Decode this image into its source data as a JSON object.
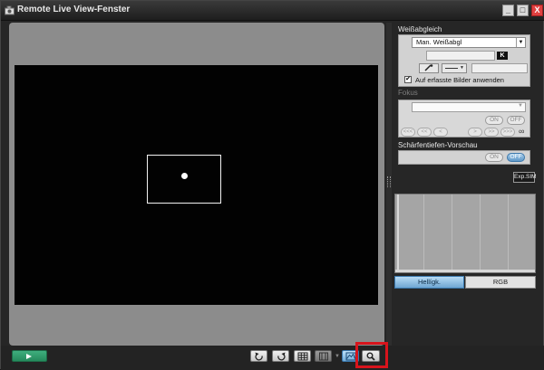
{
  "window": {
    "title": "Remote Live View-Fenster",
    "controls": [
      "_",
      "□",
      "X"
    ]
  },
  "preview": {
    "focus_frame": true,
    "background_color": "#020202"
  },
  "white_balance": {
    "header": "Weißabgleich",
    "mode": "Man. Weißabgl",
    "kelvin_badge": "K",
    "apply_checked": true,
    "apply_label": "Auf erfasste Bilder anwenden"
  },
  "focus": {
    "header": "Fokus",
    "on_label": "ON",
    "off_label": "OFF",
    "nav": [
      "<<<",
      "<<",
      "<",
      ">",
      ">>",
      ">>>"
    ],
    "infinity": "∞"
  },
  "depth_of_field": {
    "header": "Schärfentiefen-Vorschau",
    "on_label": "ON",
    "off_label": "OFF",
    "active": "OFF"
  },
  "exposure_sim": {
    "label": "Exp.SIM"
  },
  "histogram": {
    "tabs": [
      "Hellígk.",
      "RGB"
    ],
    "active_tab": "Hellígk."
  },
  "toolbar": {
    "buttons": [
      "start",
      "rotate-left",
      "rotate-right",
      "grid",
      "aspect",
      "compare",
      "zoom"
    ],
    "highlight_color": "#d8141c"
  }
}
